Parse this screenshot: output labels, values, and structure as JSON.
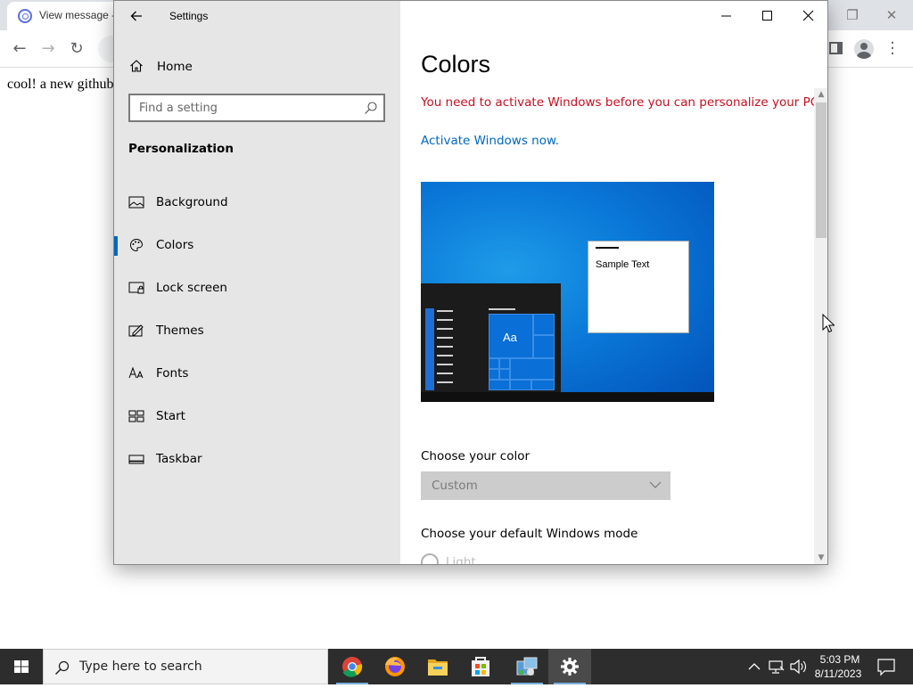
{
  "browser": {
    "tab_title": "View message -",
    "content_text": "cool! a new github",
    "nav": {
      "back": "←",
      "forward": "→",
      "reload": "↻"
    },
    "window_buttons": {
      "restore": "❐",
      "close": "✕"
    }
  },
  "settings": {
    "window_title": "Settings",
    "home_label": "Home",
    "search_placeholder": "Find a setting",
    "section_title": "Personalization",
    "nav_items": [
      {
        "label": "Background",
        "icon": "image-icon",
        "selected": false
      },
      {
        "label": "Colors",
        "icon": "palette-icon",
        "selected": true
      },
      {
        "label": "Lock screen",
        "icon": "lock-screen-icon",
        "selected": false
      },
      {
        "label": "Themes",
        "icon": "themes-icon",
        "selected": false
      },
      {
        "label": "Fonts",
        "icon": "fonts-icon",
        "selected": false
      },
      {
        "label": "Start",
        "icon": "start-icon",
        "selected": false
      },
      {
        "label": "Taskbar",
        "icon": "taskbar-icon",
        "selected": false
      }
    ],
    "content": {
      "title": "Colors",
      "activation_warning": "You need to activate Windows before you can personalize your PC.",
      "activate_link": "Activate Windows now.",
      "preview_sample_text": "Sample Text",
      "preview_tile_text": "Aa",
      "choose_color_label": "Choose your color",
      "color_dropdown_value": "Custom",
      "choose_mode_label": "Choose your default Windows mode",
      "light_option": "Light"
    },
    "colors": {
      "accent": "#0067c0",
      "warning": "#c50f1f",
      "nav_bg": "#e6e6e6"
    }
  },
  "taskbar": {
    "search_placeholder": "Type here to search",
    "apps": [
      "chrome-icon",
      "firefox-icon",
      "file-explorer-icon",
      "store-icon",
      "control-panel-icon",
      "settings-gear-icon"
    ],
    "clock_time": "5:03 PM",
    "clock_date": "8/11/2023"
  }
}
